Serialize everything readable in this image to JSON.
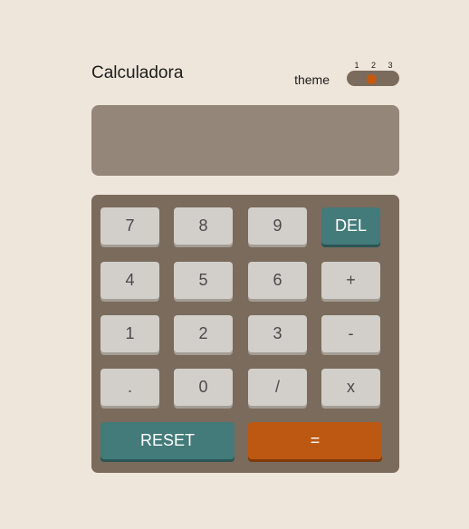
{
  "app": {
    "title": "Calculadora"
  },
  "theme": {
    "label": "theme",
    "options": [
      "1",
      "2",
      "3"
    ],
    "selected": "2"
  },
  "display": {
    "value": ""
  },
  "keys": {
    "k7": "7",
    "k8": "8",
    "k9": "9",
    "del": "DEL",
    "k4": "4",
    "k5": "5",
    "k6": "6",
    "plus": "+",
    "k1": "1",
    "k2": "2",
    "k3": "3",
    "minus": "-",
    "dot": ".",
    "k0": "0",
    "divide": "/",
    "multiply": "x",
    "reset": "RESET",
    "equals": "="
  },
  "colors": {
    "background": "#efe6db",
    "keypad": "#7a6b5c",
    "display": "#948779",
    "key": "#d2cfca",
    "accent_teal": "#437a7a",
    "accent_orange": "#bd5813"
  }
}
